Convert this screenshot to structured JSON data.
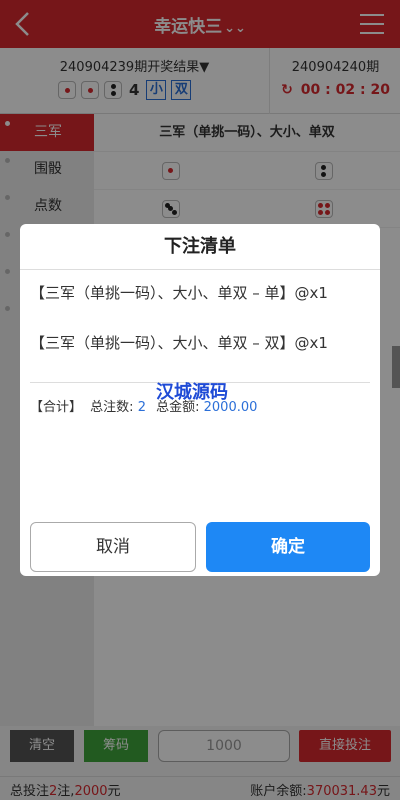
{
  "header": {
    "title": "幸运快三",
    "title_chevron": "chevron-down-icon"
  },
  "lottery": {
    "prev_label": "240904239期开奖结果",
    "dice": [
      1,
      1,
      2
    ],
    "sum": "4",
    "size": "小",
    "parity": "双",
    "next_label": "240904240期",
    "countdown": "00 : 02 : 20"
  },
  "sidebar": {
    "items": [
      {
        "label": "三军"
      },
      {
        "label": "围骰"
      },
      {
        "label": "点数"
      },
      {
        "label": ""
      },
      {
        "label": ""
      },
      {
        "label": ""
      }
    ]
  },
  "content": {
    "section_title": "三军（单挑一码）、大小、单双"
  },
  "bottom": {
    "clear": "清空",
    "chips": "筹码",
    "amount_placeholder": "1000",
    "bet": "直接投注",
    "summary_left_prefix": "总投注",
    "summary_count": "2",
    "summary_unit": "注,",
    "summary_amount": "2000",
    "summary_yuan": "元",
    "balance_label": "账户余额:",
    "balance_value": "370031.43",
    "balance_unit": "元"
  },
  "modal": {
    "title": "下注清单",
    "items": [
      "【三军（单挑一码）、大小、单双 – 单】@x1",
      "【三军（单挑一码）、大小、单双 – 双】@x1"
    ],
    "total_label": "【合计】",
    "count_label": "总注数:",
    "count_value": "2",
    "amount_label": "总金额:",
    "amount_value": "2000.00",
    "cancel": "取消",
    "confirm": "确定"
  },
  "watermark": "汉城源码",
  "colors": {
    "brand_red": "#d7282e",
    "accent_blue": "#1e88f5",
    "chip_green": "#3fa53b"
  }
}
